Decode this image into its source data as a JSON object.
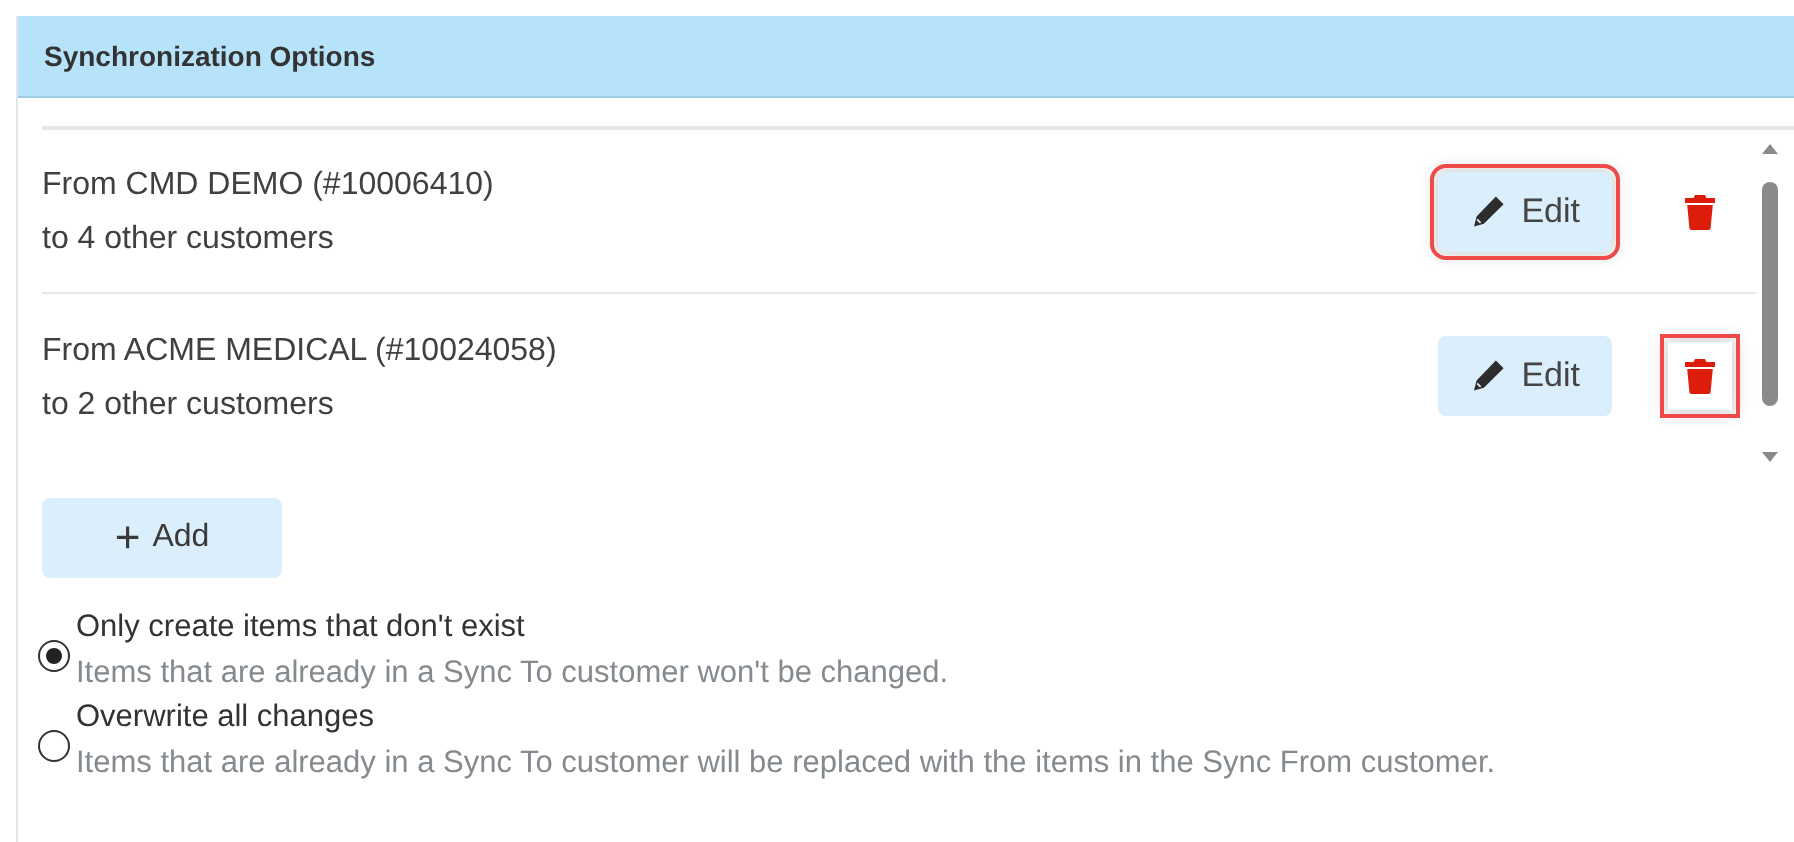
{
  "panel": {
    "title": "Synchronization Options"
  },
  "syncs": [
    {
      "source": "From CMD DEMO (#10006410)",
      "targets": "to 4 other customers",
      "edit": {
        "label": "Edit",
        "highlighted": true
      },
      "delete": {
        "highlighted": false
      }
    },
    {
      "source": "From ACME MEDICAL (#10024058)",
      "targets": "to 2 other customers",
      "edit": {
        "label": "Edit",
        "highlighted": false
      },
      "delete": {
        "highlighted": true
      }
    }
  ],
  "add_button": {
    "icon": "+",
    "label": "Add"
  },
  "options": [
    {
      "label": "Only create items that don't exist",
      "description": "Items that are already in a Sync To customer won't be changed.",
      "selected": true
    },
    {
      "label": "Overwrite all changes",
      "description": "Items that are already in a Sync To customer will be replaced with the items in the Sync From customer.",
      "selected": false
    }
  ]
}
